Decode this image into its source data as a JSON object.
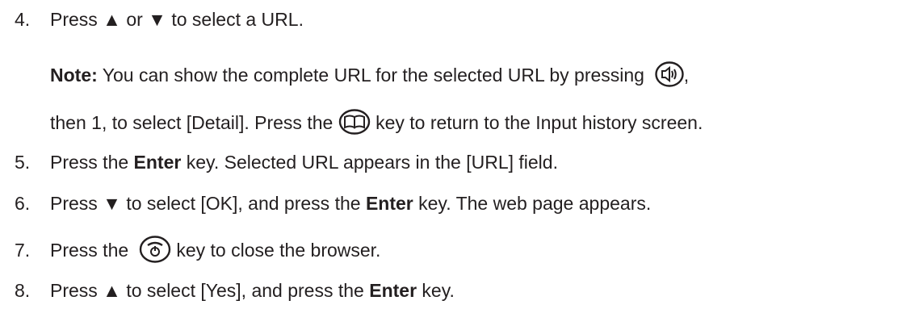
{
  "steps": [
    {
      "number": "4.",
      "text": "Press ▲ or ▼ to select a URL."
    },
    {
      "note": {
        "label": "Note:",
        "text_before_icon": " You can show the complete URL for the selected URL by pressing",
        "text_after_icon": ",",
        "icon": "speaker-key-icon",
        "line2_before_icon": "then 1, to select [Detail]. Press the",
        "line2_icon": "book-key-icon",
        "line2_after_icon": "key to return to the Input history screen."
      }
    },
    {
      "number": "5.",
      "before": "Press the ",
      "bold": "Enter",
      "after": " key. Selected URL appears in the [URL] field."
    },
    {
      "number": "6.",
      "before": "Press ▼ to select [OK], and press the ",
      "bold": "Enter",
      "after": " key. The web page appears."
    },
    {
      "number": "7.",
      "before": "Press the",
      "icon": "power-key-icon",
      "after": "key to close the browser."
    },
    {
      "number": "8.",
      "before": "Press ▲ to select [Yes], and press the ",
      "bold": "Enter",
      "after": " key."
    }
  ]
}
